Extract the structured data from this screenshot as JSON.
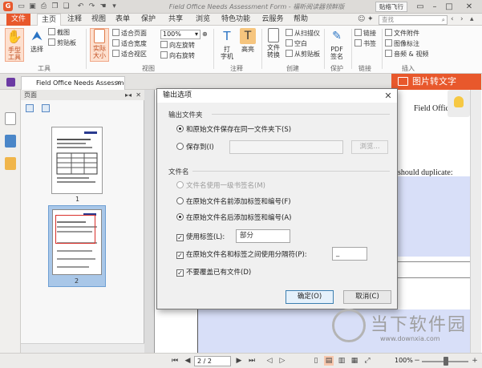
{
  "window": {
    "title": "Field Office Needs Assessment Form - 福昕阅读器领鲜版",
    "sticker_button": "贴络飞行",
    "accent_color": "#e8582c"
  },
  "menu": {
    "file": "文件",
    "tabs": [
      "主页",
      "注释",
      "视图",
      "表单",
      "保护",
      "共享",
      "浏览",
      "特色功能",
      "云服务",
      "帮助"
    ],
    "active_tab": "主页",
    "find_placeholder": "查找"
  },
  "ribbon": {
    "hand_tool": "手型\n工具",
    "select": "选择",
    "screenshot": "截图",
    "clipboard": "剪贴板",
    "group_tools": "工具",
    "actual_size": "实际\n大小",
    "fit_page": "适合页面",
    "fit_width": "适合宽度",
    "fit_visible": "适合视区",
    "zoom_value": "100%",
    "rotate_left": "向左旋转",
    "rotate_right": "向右旋转",
    "group_view": "视图",
    "typewriter": "打\n字机",
    "highlight": "高亮",
    "group_comment": "注释",
    "file_convert": "文件\n转换",
    "from_scanner": "从扫描仪",
    "blank": "空白",
    "from_clipboard": "从剪贴板",
    "group_create": "创建",
    "pdf_sign": "PDF\n签名",
    "group_protect": "保护",
    "link": "链接",
    "bookmark": "书签",
    "group_link": "链接",
    "file_attachment": "文件附件",
    "image_annotation": "图像标注",
    "audio_video": "音频 & 视频",
    "group_insert": "插入"
  },
  "doc_tab": {
    "name": "Field Office Needs Assessme..."
  },
  "banner": {
    "label": "图片转文字"
  },
  "panel": {
    "title": "页面",
    "thumbnails": [
      "1",
      "2"
    ]
  },
  "document": {
    "heading": "Field Office Needs",
    "line": "should duplicate:"
  },
  "dialog": {
    "title": "输出选项",
    "group_folder": "输出文件夹",
    "opt_same_folder": "和原始文件保存在同一文件夹下(S)",
    "opt_save_to": "保存到(I)",
    "save_to_value": "",
    "browse_button": "浏览...",
    "group_filename": "文件名",
    "opt_bookmark_name": "文件名使用一级书签名(M)",
    "opt_prefix": "在原始文件名前添加标签和编号(F)",
    "opt_suffix": "在原始文件名后添加标签和编号(A)",
    "chk_use_label": "使用标签(L):",
    "label_value": "部分",
    "chk_separator": "在原始文件名和标签之间使用分隔符(P):",
    "separator_value": "_",
    "chk_no_overwrite": "不要覆盖已有文件(D)",
    "ok_button": "确定(O)",
    "cancel_button": "取消(C)"
  },
  "statusbar": {
    "page_indicator": "2 / 2",
    "zoom_percent": "100%"
  },
  "watermark": {
    "text": "当下软件园",
    "url": "www.downxia.com"
  }
}
